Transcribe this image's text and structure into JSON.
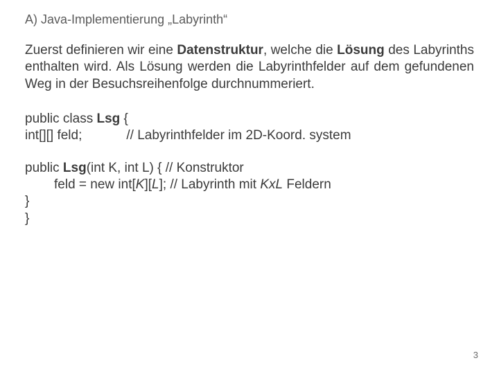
{
  "heading": "A) Java-Implementierung „Labyrinth“",
  "para": {
    "t1": "Zuerst definieren wir eine ",
    "b1": "Datenstruktur",
    "t2": ", welche die ",
    "b2": "Lösung",
    "t3": " des Labyrinths enthalten wird. Als Lösung werden die Labyrinthfelder auf dem gefundenen Weg in der Besuchsreihenfolge durchnummeriert."
  },
  "code1": {
    "l1a": "public class ",
    "l1b": "Lsg",
    "l1c": " {",
    "l2a": "int[][] feld;",
    "l2c": "// Labyrinthfelder im 2D-Koord. system"
  },
  "code2": {
    "l1a": "public ",
    "l1b": "Lsg",
    "l1c": "(int K, int L) { // Konstruktor",
    "l2a": "feld = new int[",
    "l2k": "K",
    "l2b": "][",
    "l2l": "L",
    "l2c": "]; // Labyrinth mit ",
    "l2kx": "KxL",
    "l2d": " Feldern",
    "l3": "}",
    "l4": "}"
  },
  "pagenum": "3"
}
